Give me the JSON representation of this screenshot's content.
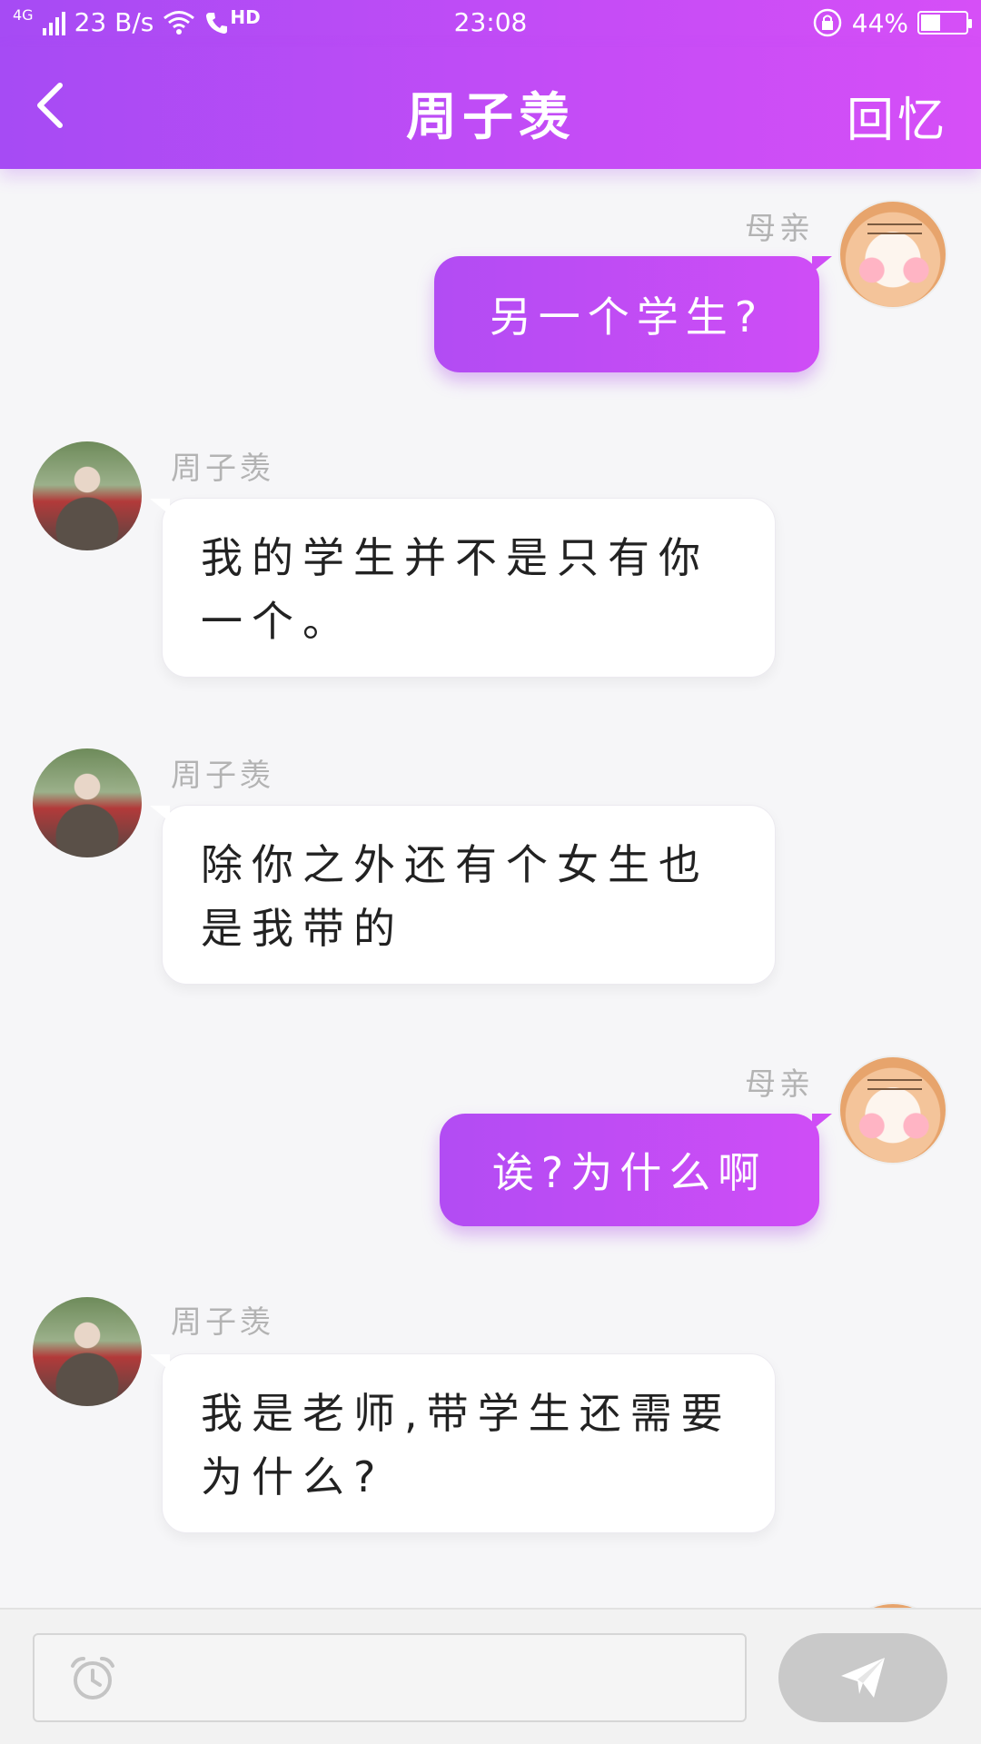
{
  "status_bar": {
    "network": "4G",
    "speed": "23 B/s",
    "hd": "HD",
    "time": "23:08",
    "battery": "44%",
    "battery_level": 0.44
  },
  "header": {
    "title": "周子羡",
    "right_action": "回忆"
  },
  "messages": [
    {
      "sender": "母亲",
      "side": "right",
      "text": "另一个学生?"
    },
    {
      "sender": "周子羡",
      "side": "left",
      "text": "我的学生并不是只有你一个。"
    },
    {
      "sender": "周子羡",
      "side": "left",
      "text": "除你之外还有个女生也是我带的"
    },
    {
      "sender": "母亲",
      "side": "right",
      "text": "诶?为什么啊"
    },
    {
      "sender": "周子羡",
      "side": "left",
      "text": "我是老师,带学生还需要为什么?"
    }
  ],
  "input": {
    "placeholder": ""
  },
  "colors": {
    "accent_start": "#a64bf4",
    "accent_end": "#d64ff7",
    "send_disabled": "#c9c9c9"
  },
  "icons": {
    "back": "chevron-left-icon",
    "alarm": "alarm-clock-icon",
    "send": "paper-plane-icon"
  }
}
